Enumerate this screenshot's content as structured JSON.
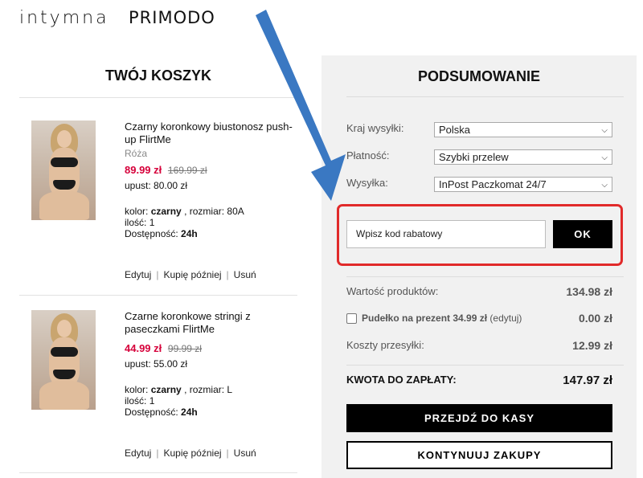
{
  "brand": {
    "logo_primary": "intymna",
    "logo_secondary": "PRIMODO"
  },
  "cart": {
    "title": "TWÓJ KOSZYK",
    "items": [
      {
        "name": "Czarny koronkowy biustonosz push-up FlirtMe",
        "variant": "Róża",
        "price": "89.99 zł",
        "old_price": "169.99 zł",
        "discount_label": "upust:",
        "discount_value": "80.00 zł",
        "color_label": "kolor:",
        "color_value": "czarny",
        "size_label": ", rozmiar:",
        "size_value": "80A",
        "qty_label": "ilość:",
        "qty_value": "1",
        "availability_label": "Dostępność:",
        "availability_value": "24h",
        "action_edit": "Edytuj",
        "action_later": "Kupię później",
        "action_remove": "Usuń"
      },
      {
        "name": "Czarne koronkowe stringi z paseczkami FlirtMe",
        "variant": "",
        "price": "44.99 zł",
        "old_price": "99.99 zł",
        "discount_label": "upust:",
        "discount_value": "55.00 zł",
        "color_label": "kolor:",
        "color_value": "czarny",
        "size_label": ", rozmiar:",
        "size_value": "L",
        "qty_label": "ilość:",
        "qty_value": "1",
        "availability_label": "Dostępność:",
        "availability_value": "24h",
        "action_edit": "Edytuj",
        "action_later": "Kupię później",
        "action_remove": "Usuń"
      }
    ]
  },
  "summary": {
    "title": "PODSUMOWANIE",
    "country_label": "Kraj wysyłki:",
    "country_value": "Polska",
    "payment_label": "Płatność:",
    "payment_value": "Szybki przelew",
    "shipping_label": "Wysyłka:",
    "shipping_value": "InPost Paczkomat 24/7",
    "promo_placeholder": "Wpisz kod rabatowy",
    "promo_button": "OK",
    "products_value_label": "Wartość produktów:",
    "products_value": "134.98 zł",
    "gift_label": "Pudełko na prezent 34.99 zł",
    "gift_edit": "(edytuj)",
    "gift_value": "0.00 zł",
    "shipping_cost_label": "Koszty przesyłki:",
    "shipping_cost_value": "12.99 zł",
    "total_label": "KWOTA DO ZAPŁATY:",
    "total_value": "147.97 zł",
    "checkout_button": "PRZEJDŹ DO KASY",
    "continue_button": "KONTYNUUJ ZAKUPY"
  },
  "colors": {
    "accent_price": "#d6003a",
    "highlight": "#e12a2a",
    "arrow": "#3a78c2"
  },
  "icons": {
    "select": "chevron-down-icon",
    "annotation": "arrow-icon"
  }
}
